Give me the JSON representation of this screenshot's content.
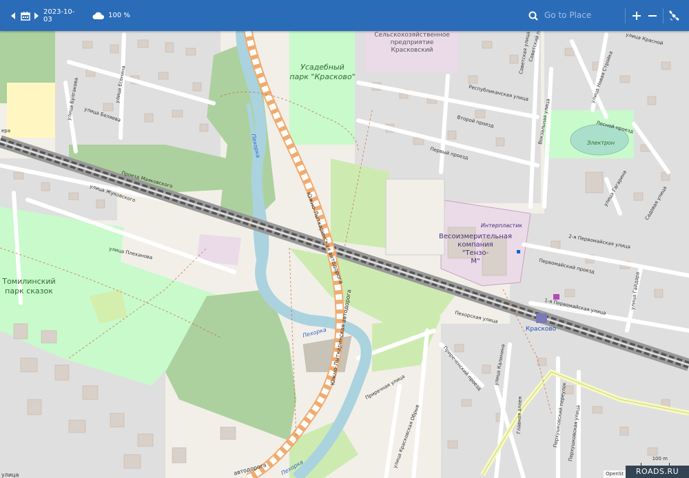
{
  "toolbar": {
    "date": "2023-10-03",
    "opacity": "100 %",
    "search_placeholder": "Go to Place",
    "icons": [
      "chevron-left-icon",
      "calendar-icon",
      "chevron-right-icon",
      "cloud-icon",
      "search-icon",
      "zoom-in-icon",
      "zoom-out-icon",
      "satellite-icon"
    ]
  },
  "map_labels": {
    "park_krasko": "Усадебный",
    "park_krasko2": "парк \"Красково\"",
    "farm1": "Сельскохозяйственное",
    "farm2": "предприятие",
    "farm3": "Красковский",
    "tomilinsky1": "Томилинский",
    "tomilinsky2": "парк сказок",
    "company1": "Весоизмерительная",
    "company2": "компания",
    "company3": "\"Тензо-",
    "company4": "М\"",
    "interplastik": "Интерпластик",
    "elektron": "Электрон",
    "station": "Красково",
    "highway1": "Южно-Лыткаринская автодорога",
    "highway2": "Южно-Лыткаринская автодорога",
    "highway3": "автодорога",
    "river1": "Пехорка",
    "river2": "Пехорка",
    "river3": "Пехорка",
    "st_bulgakova": "улица Булгакова",
    "st_belyaeva": "улица Беляева",
    "st_esenina": "улица Есенина",
    "st_mayakovskogo": "Проезд Маяковского",
    "st_zhukovskogo": "улица Жуковского",
    "st_plekhanova": "улица Плеханова",
    "st_respublikanskaya": "Республиканская улица",
    "st_vtoroy": "Второй проезд",
    "st_perviy": "Первый проезд",
    "st_lesnoy": "Лесной проезд",
    "st_sovetskaya": "Советская улица",
    "st_novaya_stroika": "улица Новая Стройка",
    "st_vokzalnaya": "Вокзальная улица",
    "st_pervomaiskiy": "Первомайский проезд",
    "st_2pervomaiskaya": "2-я Первомайская улица",
    "st_1pervomaiskaya": "1-я Первомайская улица",
    "st_pekhorskaya": "Пехорская улица",
    "st_prirechniy": "Приреченский проезд",
    "st_prirechnaya": "Приречная улица",
    "st_kalinina": "улица Калинина",
    "st_glavnaya": "Главная аллея",
    "st_perkhushkovsky": "Перхушковская улица",
    "st_perkhushkovsky_per": "Перхушковский переулок",
    "st_krasnovskaya": "улица Красковская Обрыв",
    "st_gaidara": "улица Гайдара",
    "st_sadovaya": "Садовая улица",
    "st_gagarina": "улица Гагарина",
    "st_sovetskiy_per": "Советский переулок",
    "st_krasnoy": "улица Красной",
    "st_left": "ера",
    "st_bottom_left": "улица"
  },
  "attribution": "OpenSt",
  "scale": "100 m",
  "brand": "ROADS.RU"
}
